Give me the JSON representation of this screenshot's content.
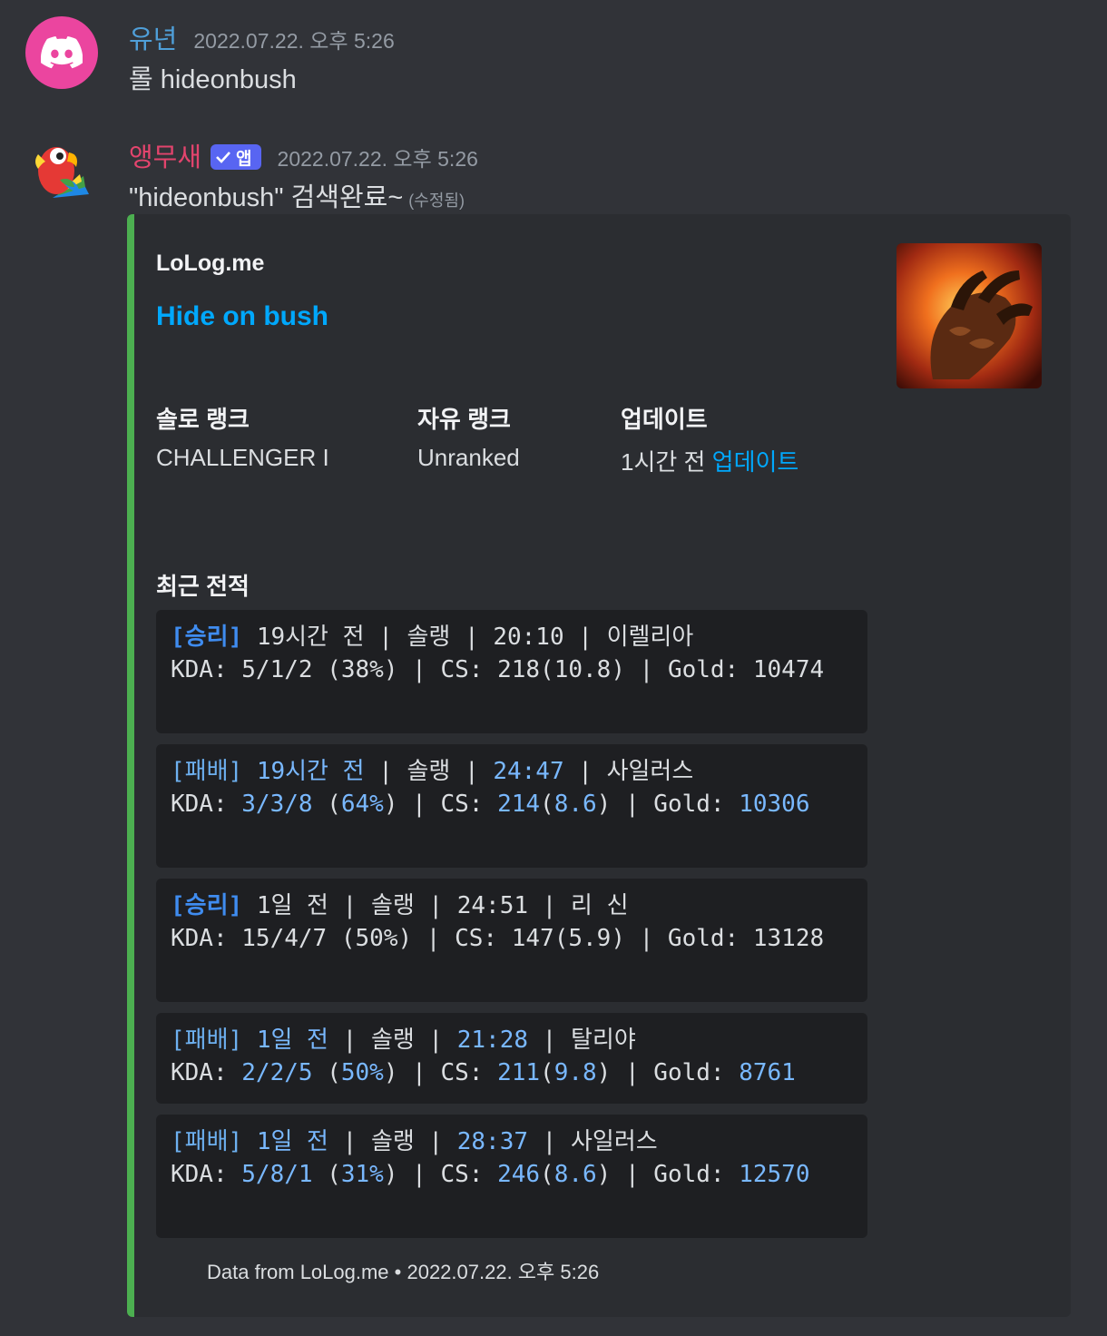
{
  "messages": [
    {
      "username": "유년",
      "timestamp": "2022.07.22. 오후 5:26",
      "content": "롤 hideonbush"
    },
    {
      "username": "앵무새",
      "badge": "앱",
      "timestamp": "2022.07.22. 오후 5:26",
      "content": "\"hideonbush\" 검색완료~",
      "edited": "(수정됨)"
    }
  ],
  "embed": {
    "accent_color": "#4caf50",
    "provider": "LoLog.me",
    "title": "Hide on bush",
    "thumbnail_icon": "champion-claw-icon",
    "fields": [
      {
        "name": "솔로 랭크",
        "value": "CHALLENGER I"
      },
      {
        "name": "자유 랭크",
        "value": "Unranked"
      },
      {
        "name": "업데이트",
        "value_prefix": "1시간 전 ",
        "value_link": "업데이트"
      }
    ],
    "recent_title": "최근 전적",
    "matches": [
      {
        "result": "[승리]",
        "time_ago": "19시간 전",
        "queue": "솔랭",
        "duration": "20:10",
        "champion": "이렐리아",
        "kda": "5/1/2",
        "kp": "38%",
        "cs": "218",
        "cs_per_min": "10.8",
        "gold": "10474"
      },
      {
        "result": "[패배]",
        "time_ago": "19시간 전",
        "queue": "솔랭",
        "duration": "24:47",
        "champion": "사일러스",
        "kda": "3/3/8",
        "kp": "64%",
        "cs": "214",
        "cs_per_min": "8.6",
        "gold": "10306"
      },
      {
        "result": "[승리]",
        "time_ago": "1일 전",
        "queue": "솔랭",
        "duration": "24:51",
        "champion": "리 신",
        "kda": "15/4/7",
        "kp": "50%",
        "cs": "147",
        "cs_per_min": "5.9",
        "gold": "13128"
      },
      {
        "result": "[패배]",
        "time_ago": "1일 전",
        "queue": "솔랭",
        "duration": "21:28",
        "champion": "탈리야",
        "kda": "2/2/5",
        "kp": "50%",
        "cs": "211",
        "cs_per_min": "9.8",
        "gold": "8761"
      },
      {
        "result": "[패배]",
        "time_ago": "1일 전",
        "queue": "솔랭",
        "duration": "28:37",
        "champion": "사일러스",
        "kda": "5/8/1",
        "kp": "31%",
        "cs": "246",
        "cs_per_min": "8.6",
        "gold": "12570"
      }
    ],
    "footer": "Data from LoLog.me • 2022.07.22. 오후 5:26"
  }
}
